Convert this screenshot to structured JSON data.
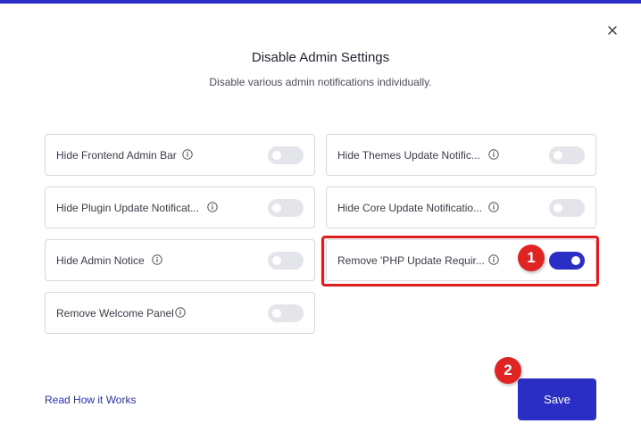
{
  "dialog": {
    "title": "Disable Admin Settings",
    "subtitle": "Disable various admin notifications individually.",
    "close_icon": "close-icon"
  },
  "settings": [
    {
      "label": "Hide Frontend Admin Bar",
      "enabled": false
    },
    {
      "label": "Hide Themes Update Notific...",
      "enabled": false
    },
    {
      "label": "Hide Plugin Update Notificat...",
      "enabled": false
    },
    {
      "label": "Hide Core Update Notificatio...",
      "enabled": false
    },
    {
      "label": "Hide Admin Notice",
      "enabled": false
    },
    {
      "label": "Remove 'PHP Update Requir...",
      "enabled": true
    },
    {
      "label": "Remove Welcome Panel",
      "enabled": false
    }
  ],
  "footer": {
    "link_label": "Read How it Works",
    "save_label": "Save"
  },
  "annotations": {
    "step1": "1",
    "step2": "2"
  },
  "colors": {
    "accent": "#2b2ec4",
    "highlight": "#e01b1b",
    "badge": "#e02424",
    "toggle_off": "#e3e5ea"
  }
}
